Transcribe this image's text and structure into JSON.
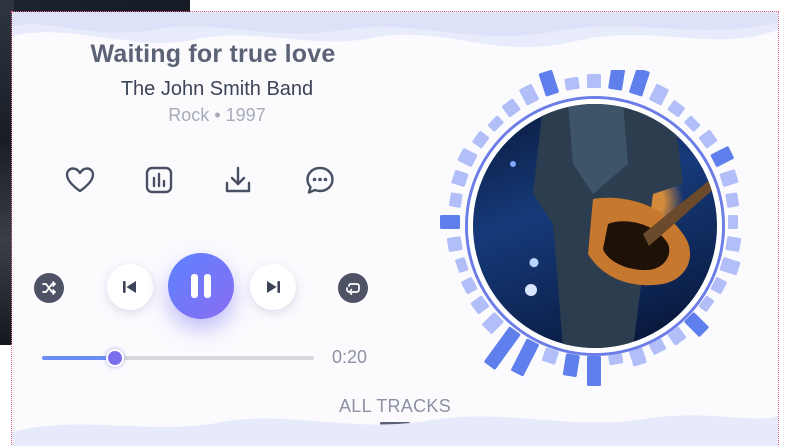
{
  "track": {
    "title": "Waiting for true love",
    "artist": "The John Smith Band",
    "genre": "Rock",
    "separator": "•",
    "year": "1997"
  },
  "actions": [
    {
      "name": "heart-icon"
    },
    {
      "name": "equalizer-icon"
    },
    {
      "name": "download-icon"
    },
    {
      "name": "chat-icon"
    }
  ],
  "controls": {
    "shuffle": "shuffle-icon",
    "previous": "skip-previous-icon",
    "play_pause": "pause-icon",
    "next": "skip-next-icon",
    "repeat": "repeat-icon"
  },
  "progress": {
    "fraction": 0.27,
    "current_time": "0:20"
  },
  "footer": {
    "all_tracks_label": "ALL TRACKS"
  },
  "colors": {
    "accent_blue": "#5c82ff",
    "accent_purple": "#8a6df2",
    "text_dark": "#3d4457",
    "text_muted": "#a7abba"
  }
}
